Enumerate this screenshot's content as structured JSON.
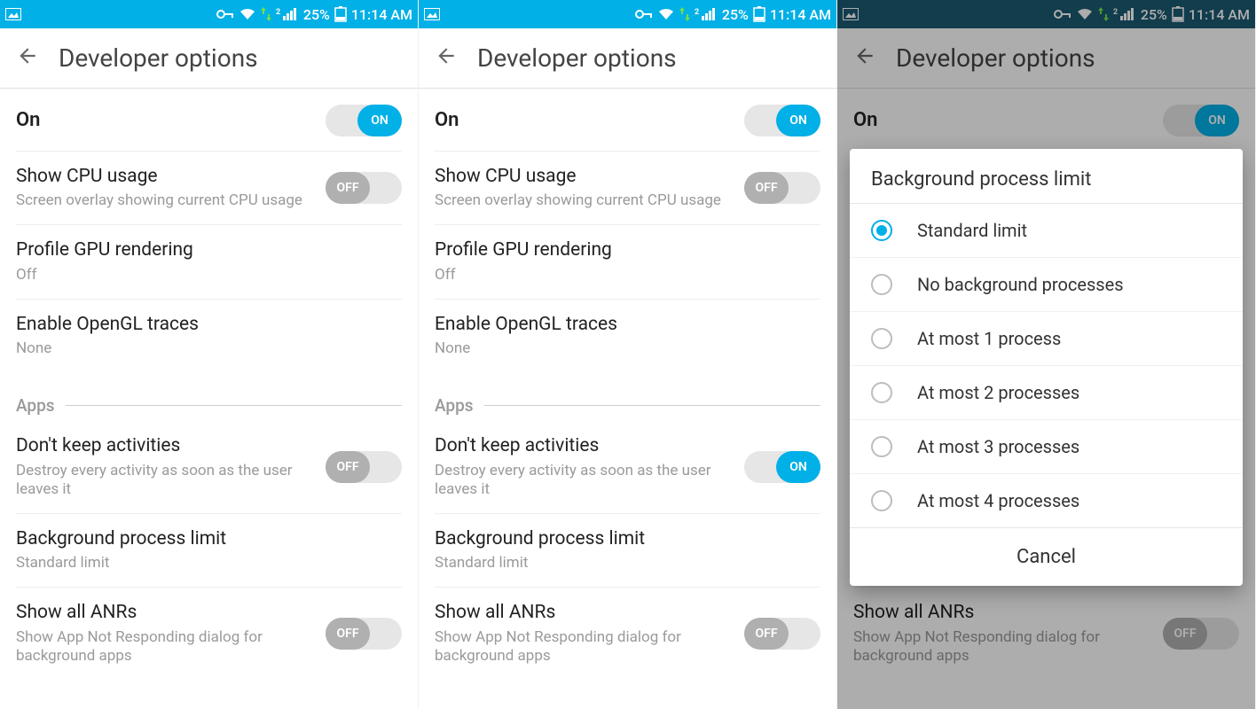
{
  "statusbar": {
    "battery_pct": "25%",
    "time": "11:14 AM"
  },
  "header": {
    "title": "Developer options"
  },
  "toggle_labels": {
    "on": "ON",
    "off": "OFF"
  },
  "main_toggle": {
    "label": "On"
  },
  "settings": {
    "cpu": {
      "title": "Show CPU usage",
      "sub": "Screen overlay showing current CPU usage"
    },
    "gpu": {
      "title": "Profile GPU rendering",
      "sub": "Off"
    },
    "opengl": {
      "title": "Enable OpenGL traces",
      "sub": "None"
    }
  },
  "section_apps": "Apps",
  "apps": {
    "dka": {
      "title": "Don't keep activities",
      "sub": "Destroy every activity as soon as the user leaves it"
    },
    "bpl": {
      "title": "Background process limit",
      "sub": "Standard limit"
    },
    "anr": {
      "title": "Show all ANRs",
      "sub": "Show App Not Responding dialog for background apps"
    }
  },
  "dialog": {
    "title": "Background process limit",
    "options": [
      "Standard limit",
      "No background processes",
      "At most 1 process",
      "At most 2 processes",
      "At most 3 processes",
      "At most 4 processes"
    ],
    "selected": 0,
    "cancel": "Cancel"
  },
  "screens": [
    {
      "dka_on": false
    },
    {
      "dka_on": true
    },
    {
      "dka_on": true,
      "dialog_open": true
    }
  ]
}
